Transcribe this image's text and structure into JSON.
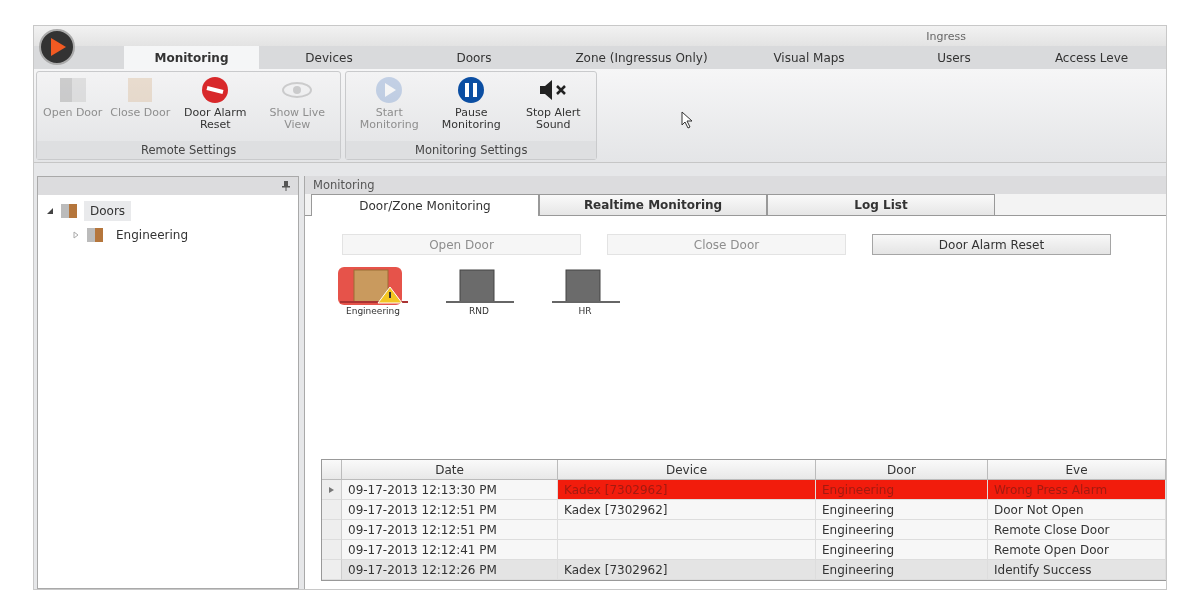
{
  "window": {
    "title": "Ingress"
  },
  "tabs": [
    {
      "label": "Monitoring",
      "selected": true
    },
    {
      "label": "Devices",
      "selected": false
    },
    {
      "label": "Doors",
      "selected": false
    },
    {
      "label": "Zone (Ingressus Only)",
      "selected": false
    },
    {
      "label": "Visual Maps",
      "selected": false
    },
    {
      "label": "Users",
      "selected": false
    },
    {
      "label": "Access Leve",
      "selected": false
    }
  ],
  "ribbon_groups": [
    {
      "title": "Remote Settings",
      "buttons": [
        {
          "kind": "open-door",
          "label": "Open Door",
          "disabled": true
        },
        {
          "kind": "close-door",
          "label": "Close Door",
          "disabled": true
        },
        {
          "kind": "alarm-reset",
          "label": "Door Alarm Reset",
          "disabled": false
        },
        {
          "kind": "view",
          "label": "Show Live View",
          "disabled": true
        }
      ]
    },
    {
      "title": "Monitoring Settings",
      "buttons": [
        {
          "kind": "play",
          "label": "Start Monitoring",
          "disabled": true
        },
        {
          "kind": "pause",
          "label": "Pause Monitoring",
          "disabled": false
        },
        {
          "kind": "mute",
          "label": "Stop Alert Sound",
          "disabled": false
        }
      ]
    }
  ],
  "tree": [
    {
      "label": "Doors",
      "expanded": true,
      "selected": true,
      "children": [
        {
          "label": "Engineering",
          "expanded": false,
          "selected": false
        }
      ]
    }
  ],
  "panel": {
    "title": "Monitoring"
  },
  "sub_tabs": [
    {
      "label": "Door/Zone Monitoring",
      "selected": true
    },
    {
      "label": "Realtime Monitoring",
      "selected": false
    },
    {
      "label": "Log List",
      "selected": false
    }
  ],
  "actions": [
    {
      "label": "Open Door",
      "disabled": true
    },
    {
      "label": "Close Door",
      "disabled": true
    },
    {
      "label": "Door Alarm Reset",
      "disabled": false
    }
  ],
  "doors": [
    {
      "name": "Engineering",
      "alarm": true
    },
    {
      "name": "RND",
      "alarm": false
    },
    {
      "name": "HR",
      "alarm": false
    }
  ],
  "log": {
    "columns": [
      "Date",
      "Device",
      "Door",
      "Eve"
    ],
    "rows": [
      {
        "current": true,
        "alarm": true,
        "cells": [
          "09-17-2013 12:13:30 PM",
          "Kadex [7302962]",
          "Engineering",
          "Wrong Press Alarm"
        ]
      },
      {
        "current": false,
        "alarm": false,
        "cells": [
          "09-17-2013 12:12:51 PM",
          "Kadex [7302962]",
          "Engineering",
          "Door Not Open"
        ]
      },
      {
        "current": false,
        "alarm": false,
        "cells": [
          "09-17-2013 12:12:51 PM",
          "",
          "Engineering",
          "Remote Close Door"
        ]
      },
      {
        "current": false,
        "alarm": false,
        "cells": [
          "09-17-2013 12:12:41 PM",
          "",
          "Engineering",
          "Remote Open Door"
        ]
      },
      {
        "current": false,
        "alarm": false,
        "cells": [
          "09-17-2013 12:12:26 PM",
          "Kadex [7302962]",
          "Engineering",
          "Identify Success"
        ]
      }
    ]
  }
}
